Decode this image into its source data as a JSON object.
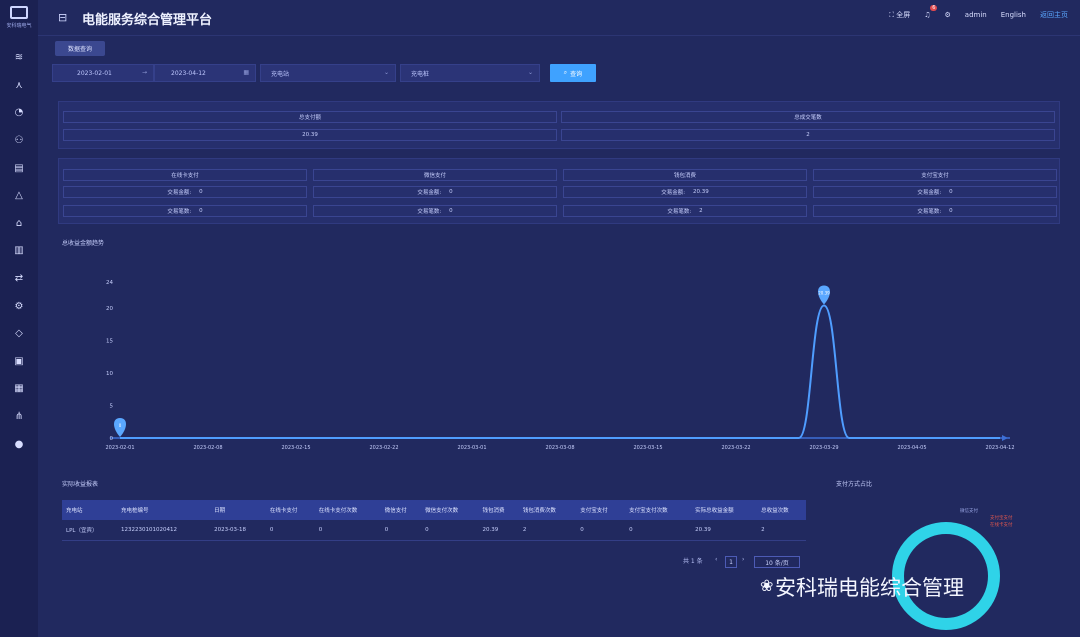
{
  "header": {
    "logo_text": "安科瑞电气",
    "title": "电能服务综合管理平台",
    "fullscreen_label": "全屏",
    "notification_count": "6",
    "user_name": "admin",
    "language": "English",
    "home_link": "返回主页"
  },
  "tab": {
    "label": "数据查询"
  },
  "filters": {
    "start_date": "2023-02-01",
    "end_date": "2023-04-12",
    "station_placeholder": "充电站",
    "pile_placeholder": "充电桩",
    "search_label": "查询"
  },
  "summary": {
    "total_amount_label": "总支付额",
    "total_amount_value": "20.39",
    "total_count_label": "总成交笔数",
    "total_count_value": "2"
  },
  "payments": [
    {
      "name": "在线卡支付",
      "amount_label": "交易金额:",
      "amount": "0",
      "count_label": "交易笔数:",
      "count": "0"
    },
    {
      "name": "微信支付",
      "amount_label": "交易金额:",
      "amount": "0",
      "count_label": "交易笔数:",
      "count": "0"
    },
    {
      "name": "钱包消费",
      "amount_label": "交易金额:",
      "amount": "20.39",
      "count_label": "交易笔数:",
      "count": "2"
    },
    {
      "name": "支付宝支付",
      "amount_label": "交易金额:",
      "amount": "0",
      "count_label": "交易笔数:",
      "count": "0"
    }
  ],
  "trend": {
    "title": "总收益金额趋势"
  },
  "chart_data": {
    "type": "line",
    "title": "总收益金额趋势",
    "x": [
      "2023-02-01",
      "2023-02-08",
      "2023-02-15",
      "2023-02-22",
      "2023-03-01",
      "2023-03-08",
      "2023-03-15",
      "2023-03-22",
      "2023-03-29",
      "2023-04-05",
      "2023-04-12"
    ],
    "xlabels_shown": [
      "2023-02-01",
      "2023-02-08",
      "2023-02-15",
      "2023-02-22",
      "2023-03-01",
      "2023-03-08",
      "2023-03-15",
      "2023-03-22",
      "2023-03-29",
      "2023-04-05",
      "2023-04-12"
    ],
    "yticks": [
      0,
      5,
      10,
      15,
      20,
      24
    ],
    "ylim": [
      0,
      24
    ],
    "series": [
      {
        "points": [
          {
            "x": "2023-02-01",
            "y": 0
          },
          {
            "x": "2023-03-27",
            "y": 0
          },
          {
            "x": "2023-03-29",
            "y": 20.39
          },
          {
            "x": "2023-03-31",
            "y": 0
          },
          {
            "x": "2023-04-12",
            "y": 0
          }
        ]
      }
    ],
    "markers": [
      {
        "x": "2023-02-01",
        "y": 0,
        "label": "0"
      },
      {
        "x": "2023-03-29",
        "y": 20.39,
        "label": "20.39"
      }
    ],
    "color": "#4f9dff",
    "grid": false
  },
  "details": {
    "title": "实际收益报表",
    "columns": [
      "充电站",
      "充电桩编号",
      "日期",
      "在线卡支付",
      "在线卡支付次数",
      "微信支付",
      "微信支付次数",
      "钱包消费",
      "钱包消费次数",
      "支付宝支付",
      "支付宝支付次数",
      "实际总收益金额",
      "总收益次数"
    ],
    "rows": [
      [
        "LPL（宜宾）",
        "1232230101020412",
        "2023-03-18",
        "0",
        "0",
        "0",
        "0",
        "20.39",
        "2",
        "0",
        "0",
        "20.39",
        "2"
      ]
    ],
    "pagination": {
      "total": "共 1 条",
      "page": "1",
      "page_size": "10 条/页"
    }
  },
  "ratio": {
    "title": "支付方式占比",
    "legend": [
      "微信支付",
      "支付宝支付",
      "在线卡支付"
    ]
  },
  "watermark": {
    "text": "安科瑞电能综合管理"
  }
}
